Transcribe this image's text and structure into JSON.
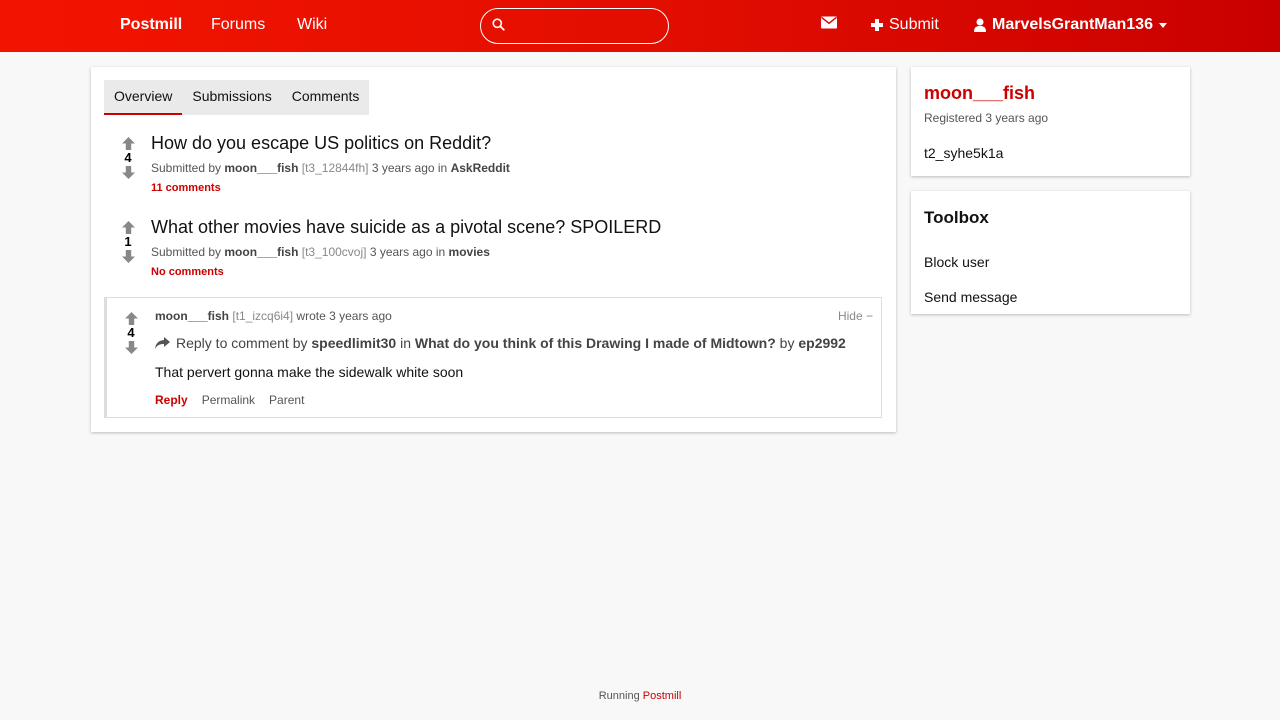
{
  "header": {
    "brand": "Postmill",
    "nav": [
      "Forums",
      "Wiki"
    ],
    "search_placeholder": "",
    "submit_label": "Submit",
    "username": "MarvelsGrantMan136",
    "icons": [
      "search-icon",
      "envelope-icon",
      "plus-icon",
      "user-icon",
      "caret-down-icon"
    ]
  },
  "tabs": [
    "Overview",
    "Submissions",
    "Comments"
  ],
  "submissions": [
    {
      "score": "4",
      "title": "How do you escape US politics on Reddit?",
      "submitted_by": "Submitted by",
      "author": "moon___fish",
      "id": "[t3_12844fh]",
      "time": "3 years ago in",
      "forum": "AskReddit",
      "comments": "11 comments"
    },
    {
      "score": "1",
      "title": "What other movies have suicide as a pivotal scene? SPOILERD",
      "submitted_by": "Submitted by",
      "author": "moon___fish",
      "id": "[t3_100cvoj]",
      "time": "3 years ago in",
      "forum": "movies",
      "comments": "No comments"
    }
  ],
  "comment": {
    "score": "4",
    "author": "moon___fish",
    "id": "[t1_izcq6i4]",
    "wrote": "wrote 3 years ago",
    "hide": "Hide −",
    "reply_prefix": "Reply to comment by",
    "reply_user": "speedlimit30",
    "in": "in",
    "post_title": "What do you think of this Drawing I made of Midtown?",
    "by": "by",
    "post_author": "ep2992",
    "body": "That pervert gonna make the sidewalk white soon",
    "actions": [
      "Reply",
      "Permalink",
      "Parent"
    ]
  },
  "sidebar": {
    "username": "moon___fish",
    "registered": "Registered 3 years ago",
    "user_id": "t2_syhe5k1a",
    "toolbox_title": "Toolbox",
    "toolbox_items": [
      "Block user",
      "Send message"
    ]
  },
  "footer": {
    "running": "Running",
    "link": "Postmill"
  },
  "colors": {
    "accent": "#cc0000",
    "header_start": "#f31400",
    "header_end": "#c90000"
  }
}
